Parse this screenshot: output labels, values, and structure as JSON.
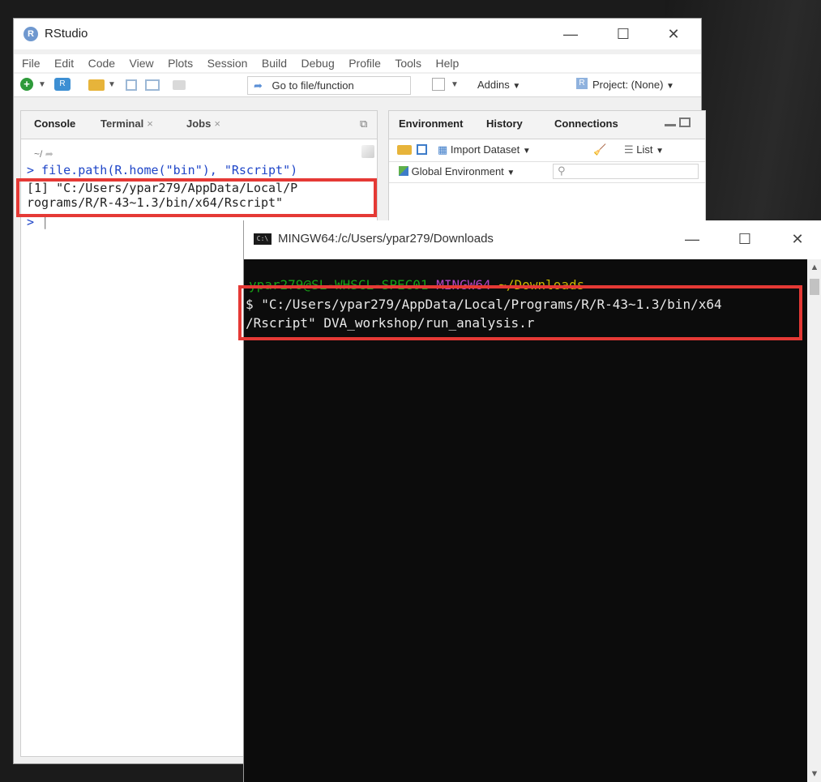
{
  "rstudio": {
    "title": "RStudio",
    "logo_letter": "R",
    "menu": [
      "File",
      "Edit",
      "Code",
      "View",
      "Plots",
      "Session",
      "Build",
      "Debug",
      "Profile",
      "Tools",
      "Help"
    ],
    "toolbar": {
      "goto_placeholder": "Go to file/function",
      "addins_label": "Addins",
      "project_label": "Project: (None)"
    },
    "console_pane": {
      "tabs": [
        "Console",
        "Terminal",
        "Jobs"
      ],
      "path": "~/",
      "command_line": "> file.path(R.home(\"bin\"), \"Rscript\")",
      "output_line_1": "[1] \"C:/Users/ypar279/AppData/Local/P",
      "output_line_2": "rograms/R/R-43~1.3/bin/x64/Rscript\"",
      "prompt": ">"
    },
    "env_pane": {
      "tabs": [
        "Environment",
        "History",
        "Connections"
      ],
      "import_label": "Import Dataset",
      "list_label": "List",
      "scope_label": "Global Environment"
    }
  },
  "mingw": {
    "title": "MINGW64:/c/Users/ypar279/Downloads",
    "icon_label": "C:\\",
    "prompt_user": "ypar279@SL-WHSCL-SPEC01",
    "prompt_shell": "MINGW64",
    "prompt_path": "~/Downloads",
    "command_line_1": "$ \"C:/Users/ypar279/AppData/Local/Programs/R/R-43~1.3/bin/x64",
    "command_line_2": "/Rscript\" DVA_workshop/run_analysis.r"
  },
  "colors": {
    "highlight": "#e53935",
    "console_command": "#1f46c8",
    "prompt_user": "#16a116",
    "prompt_shell": "#b146c2",
    "prompt_path": "#c7b600"
  }
}
